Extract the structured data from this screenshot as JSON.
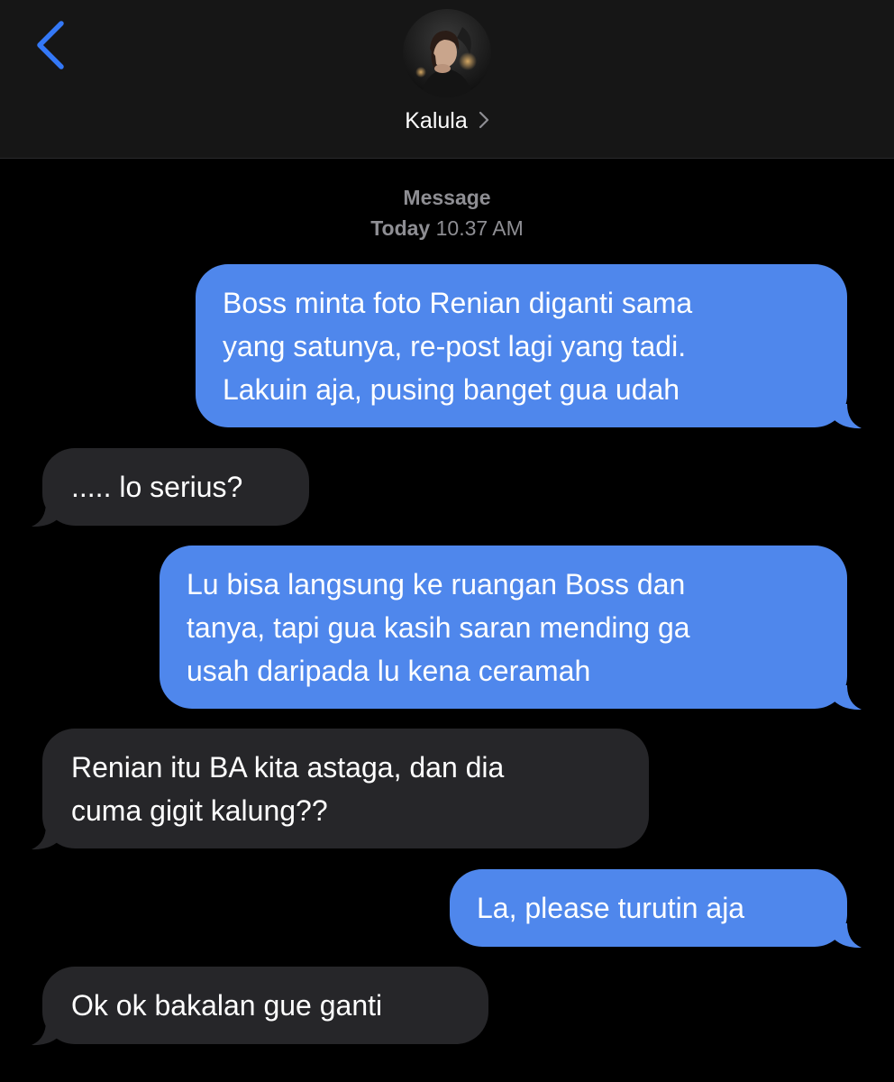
{
  "header": {
    "back_icon": "chevron-left-icon",
    "contact_name": "Kalula",
    "name_chevron_icon": "chevron-right-icon"
  },
  "thread": {
    "service_label": "Message",
    "timestamp_day": "Today",
    "timestamp_time": "10.37 AM"
  },
  "messages": [
    {
      "direction": "outgoing",
      "text": "Boss minta foto Renian diganti sama\nyang satunya, re-post lagi yang tadi.\nLakuin aja, pusing banget gua udah"
    },
    {
      "direction": "incoming",
      "text": "..... lo serius?"
    },
    {
      "direction": "outgoing",
      "text": "Lu bisa langsung ke ruangan Boss dan\ntanya, tapi gua kasih saran mending ga\nusah daripada lu kena ceramah"
    },
    {
      "direction": "incoming",
      "text": "Renian itu BA kita astaga, dan dia\ncuma gigit kalung??"
    },
    {
      "direction": "outgoing",
      "text": "La, please turutin aja"
    },
    {
      "direction": "incoming",
      "text": "Ok ok bakalan gue ganti"
    }
  ],
  "colors": {
    "background": "#000000",
    "header_background": "#161616",
    "outgoing_bubble": "#4f87ec",
    "incoming_bubble": "#262629",
    "accent_blue": "#3478f6",
    "secondary_text": "#8e8e93"
  }
}
